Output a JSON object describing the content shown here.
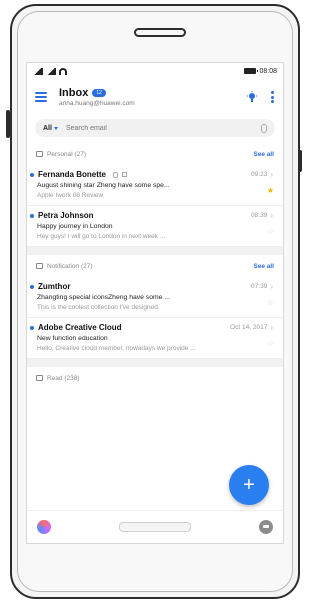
{
  "status": {
    "time": "08:08"
  },
  "header": {
    "title": "Inbox",
    "badge": "12",
    "account": "anna.huang@huawei.com",
    "icons": {
      "menu": "menu-icon",
      "theme": "bulb-icon",
      "more": "more-vertical-icon"
    },
    "accent": "#2a6de0"
  },
  "search": {
    "filter": "All",
    "placeholder": "Search email"
  },
  "sections": [
    {
      "label": "Personal (27)",
      "see_all": "See all",
      "mails": [
        {
          "sender": "Fernanda Bonette",
          "date": "09:23",
          "subject": "August shining star Zheng have some spe...",
          "preview": "Apple Iwork 08 Review",
          "starred": true,
          "unread": true
        },
        {
          "sender": "Petra Johnson",
          "date": "08:39",
          "subject": "Happy journey in London",
          "preview": "Hey guys! I will go to London in next week ...",
          "starred": false,
          "unread": true
        }
      ]
    },
    {
      "label": "Notification (27)",
      "see_all": "See all",
      "mails": [
        {
          "sender": "Zumthor",
          "date": "07:39",
          "subject": "Zhangting special iconsZheng have some ...",
          "preview": "This is the coolest collection I've designed.",
          "starred": false,
          "unread": true
        },
        {
          "sender": "Adobe Creative Cloud",
          "date": "Oct 14, 2017",
          "subject": "New function education",
          "preview": "Hello, Creative cloud member, nowadays we provide ...",
          "starred": false,
          "unread": true
        }
      ]
    }
  ],
  "read_section": {
    "label": "Read (238)"
  },
  "fab": {
    "label": "+"
  }
}
